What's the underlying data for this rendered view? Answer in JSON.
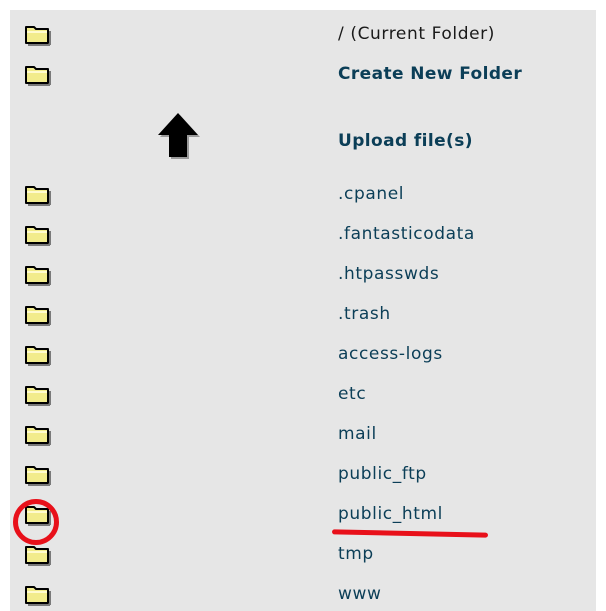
{
  "top_rows": [
    {
      "label": "/ (Current Folder)",
      "icon": "folder-icon",
      "style": "plain"
    },
    {
      "label": "Create New Folder",
      "icon": "folder-icon",
      "style": "bold"
    }
  ],
  "upload": {
    "label": "Upload file(s)",
    "icon": "up-arrow-icon"
  },
  "folders": [
    ".cpanel",
    ".fantasticodata",
    ".htpasswds",
    ".trash",
    "access-logs",
    "etc",
    "mail",
    "public_ftp",
    "public_html",
    "tmp",
    "www"
  ],
  "highlight": {
    "folder": "public_html",
    "color": "#e8101a"
  },
  "colors": {
    "folder_fill": "#f2ec8c",
    "folder_outline": "#000000",
    "link": "#0b3e57",
    "panel": "#e6e6e6"
  }
}
